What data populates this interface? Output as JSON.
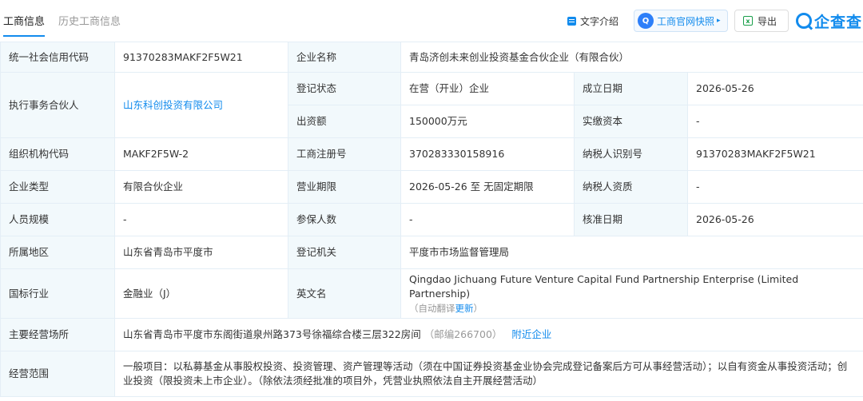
{
  "tabs": {
    "active": "工商信息",
    "inactive": "历史工商信息"
  },
  "toolbar": {
    "intro_label": "文字介绍",
    "snapshot_label": "工商官网快照",
    "snapshot_arrow": "▸",
    "export_label": "导出",
    "logo_text": "企查查",
    "excel_glyph": "x",
    "snap_glyph": "Q"
  },
  "info": {
    "credit_code_label": "统一社会信用代码",
    "credit_code": "91370283MAKF2F5W21",
    "company_name_label": "企业名称",
    "company_name": "青岛济创未来创业投资基金合伙企业（有限合伙）",
    "partner_label": "执行事务合伙人",
    "partner": "山东科创投资有限公司",
    "reg_status_label": "登记状态",
    "reg_status": "在营（开业）企业",
    "founded_label": "成立日期",
    "founded": "2026-05-26",
    "capital_label": "出资额",
    "capital": "150000万元",
    "paid_capital_label": "实缴资本",
    "paid_capital": "-",
    "org_code_label": "组织机构代码",
    "org_code": "MAKF2F5W-2",
    "biz_reg_no_label": "工商注册号",
    "biz_reg_no": "370283330158916",
    "taxpayer_id_label": "纳税人识别号",
    "taxpayer_id": "91370283MAKF2F5W21",
    "company_type_label": "企业类型",
    "company_type": "有限合伙企业",
    "term_label": "营业期限",
    "term": "2026-05-26 至 无固定期限",
    "taxpayer_qual_label": "纳税人资质",
    "taxpayer_qual": "-",
    "staff_size_label": "人员规模",
    "staff_size": "-",
    "insured_label": "参保人数",
    "insured": "-",
    "approval_date_label": "核准日期",
    "approval_date": "2026-05-26",
    "region_label": "所属地区",
    "region": "山东省青岛市平度市",
    "reg_authority_label": "登记机关",
    "reg_authority": "平度市市场监督管理局",
    "industry_label": "国标行业",
    "industry": "金融业（J）",
    "english_name_label": "英文名",
    "english_name": "Qingdao Jichuang Future Venture Capital Fund Partnership Enterprise (Limited Partnership)",
    "auto_translate_prefix": "（自动翻译",
    "auto_translate_link": "更新",
    "auto_translate_suffix": "）",
    "address_label": "主要经营场所",
    "address": "山东省青岛市平度市东阁街道泉州路373号徐福综合楼三层322房间",
    "postcode": "（邮编266700）",
    "nearby_link": "附近企业",
    "scope_label": "经营范围",
    "scope": "一般项目：以私募基金从事股权投资、投资管理、资产管理等活动（须在中国证券投资基金业协会完成登记备案后方可从事经营活动）；以自有资金从事投资活动；创业投资（限投资未上市企业）。（除依法须经批准的项目外，凭营业执照依法自主开展经营活动）"
  }
}
